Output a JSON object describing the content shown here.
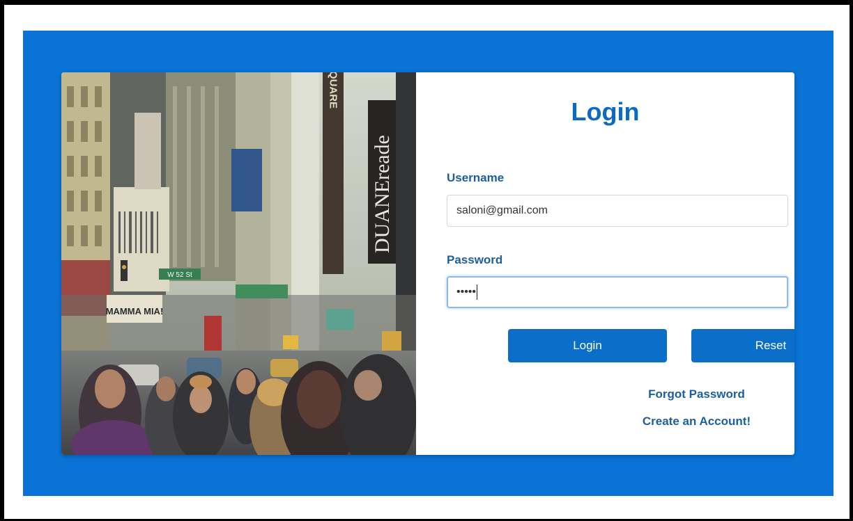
{
  "login_form": {
    "title": "Login",
    "username_label": "Username",
    "username_value": "saloni@gmail.com",
    "password_label": "Password",
    "password_value": "•••••",
    "login_button": "Login",
    "reset_button": "Reset",
    "forgot_password_link": "Forgot Password",
    "create_account_link": "Create an Account!"
  },
  "photo": {
    "signs": {
      "duane_reade": "DUANEreade",
      "square": "SQUARE",
      "street": "W 52 St",
      "theater": "MAMMA MIA!"
    }
  },
  "colors": {
    "panel_blue": "#0b72d6",
    "button_blue": "#0b6ec9",
    "title_blue": "#0b6ac6",
    "label_blue": "#1d5f9e"
  }
}
